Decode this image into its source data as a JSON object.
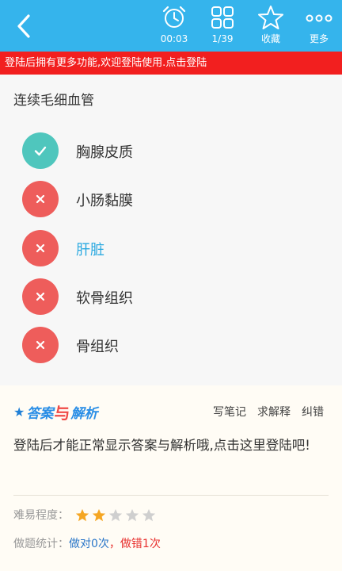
{
  "toolbar": {
    "timer_label": "00:03",
    "progress_label": "1/39",
    "favorite_label": "收藏",
    "more_label": "更多"
  },
  "banner": {
    "text": "登陆后拥有更多功能,欢迎登陆使用.点击登陆"
  },
  "question": {
    "title": "连续毛细血管",
    "options": [
      {
        "label": "胸腺皮质",
        "status": "correct"
      },
      {
        "label": "小肠黏膜",
        "status": "wrong"
      },
      {
        "label": "肝脏",
        "status": "wrong",
        "selected": true
      },
      {
        "label": "软骨组织",
        "status": "wrong"
      },
      {
        "label": "骨组织",
        "status": "wrong"
      }
    ]
  },
  "answer": {
    "logo_part1": "答案",
    "logo_part2": "与",
    "logo_part3": "解析",
    "actions": [
      "写笔记",
      "求解释",
      "纠错"
    ],
    "login_prompt": "登陆后才能正常显示答案与解析哦,点击这里登陆吧!",
    "difficulty_label": "难易程度：",
    "difficulty_rating": 2,
    "difficulty_max": 5,
    "stats_label": "做题统计：",
    "stats_correct": "做对0次",
    "stats_sep": "，",
    "stats_wrong": "做错1次"
  },
  "colors": {
    "primary": "#35b4ec",
    "banner_red": "#f21f1f",
    "correct": "#4fc6bd",
    "wrong": "#ee5d5b",
    "star_on": "#f5a623",
    "star_off": "#cfcfcf"
  }
}
